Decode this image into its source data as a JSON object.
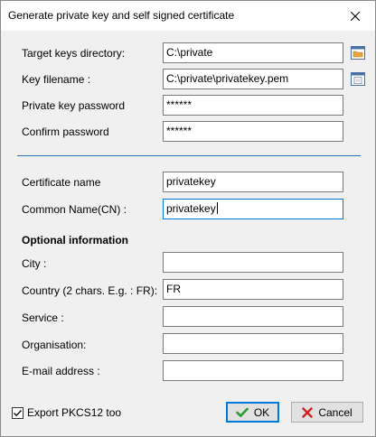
{
  "window": {
    "title": "Generate private key and self signed certificate"
  },
  "fields": {
    "target_dir": {
      "label": "Target keys directory:",
      "value": "C:\\private"
    },
    "key_filename": {
      "label": "Key filename :",
      "value": "C:\\private\\privatekey.pem"
    },
    "key_password": {
      "label": "Private key password",
      "value": "******"
    },
    "confirm_password": {
      "label": "Confirm password",
      "value": "******"
    },
    "cert_name": {
      "label": "Certificate name",
      "value": "privatekey"
    },
    "common_name": {
      "label": "Common Name(CN) :",
      "value": "privatekey"
    },
    "optional_title": "Optional information",
    "city": {
      "label": "City :",
      "value": ""
    },
    "country": {
      "label": "Country (2 chars. E.g. : FR):",
      "value": "FR"
    },
    "service": {
      "label": "Service :",
      "value": ""
    },
    "organisation": {
      "label": "Organisation:",
      "value": ""
    },
    "email": {
      "label": "E-mail address :",
      "value": ""
    }
  },
  "footer": {
    "export_pkcs12": {
      "label": "Export PKCS12 too",
      "checked": true
    },
    "ok_label": "OK",
    "cancel_label": "Cancel"
  },
  "colors": {
    "separator": "#2a6fb3",
    "focus_border": "#0078d7",
    "ok_check": "#2e9b2e",
    "cancel_x": "#d22020",
    "folder_icon": "#e8a33a"
  },
  "icons": {
    "close": "close-icon",
    "folder": "folder-icon",
    "file": "file-icon",
    "check": "check-icon",
    "cancel": "cancel-x-icon",
    "checkbox_check": "checkmark-icon"
  }
}
